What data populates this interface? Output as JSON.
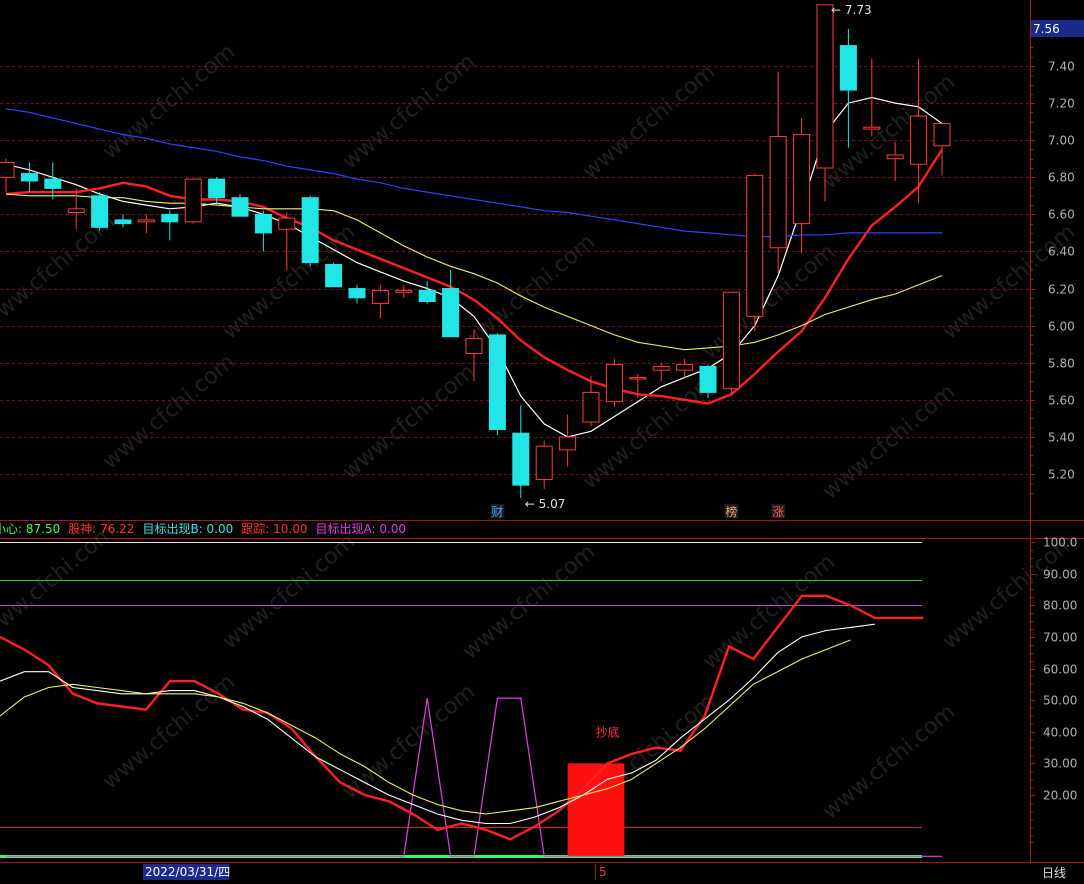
{
  "ui": {
    "date_label": "2022/03/31/四",
    "cursor_label": "5",
    "period_label": "日线",
    "current_price": "7.56",
    "high_note": "7.73",
    "low_note": "5.07",
    "signal_label": "抄底",
    "event_labels": [
      {
        "text": "财",
        "color": "#4aa8ff",
        "bar": 21
      },
      {
        "text": "榜",
        "color": "#e8b060",
        "bar": 31
      },
      {
        "text": "涨",
        "color": "#ff5050",
        "bar": 33
      }
    ],
    "watermark": "www.cfchi.com"
  },
  "legend": [
    {
      "label": "小心: ",
      "value": "87.50",
      "color": "#40ff40"
    },
    {
      "label": "股神: ",
      "value": "76.22",
      "color": "#ff3030"
    },
    {
      "label": "目标出现B: ",
      "value": "0.00",
      "color": "#40e0e0"
    },
    {
      "label": "跟踪: ",
      "value": "10.00",
      "color": "#ff3030"
    },
    {
      "label": "目标出现A: ",
      "value": "0.00",
      "color": "#e040e0"
    }
  ],
  "chart_data": [
    {
      "type": "candlestick",
      "ylim": [
        5.07,
        7.73
      ],
      "y_ticks": [
        "7.40",
        "7.20",
        "7.00",
        "6.80",
        "6.60",
        "6.40",
        "6.20",
        "6.00",
        "5.80",
        "5.60",
        "5.40",
        "5.20"
      ],
      "candles": [
        {
          "o": 6.8,
          "h": 6.9,
          "l": 6.72,
          "c": 6.88
        },
        {
          "o": 6.82,
          "h": 6.88,
          "l": 6.72,
          "c": 6.78
        },
        {
          "o": 6.79,
          "h": 6.88,
          "l": 6.68,
          "c": 6.74
        },
        {
          "o": 6.61,
          "h": 6.74,
          "l": 6.52,
          "c": 6.63
        },
        {
          "o": 6.7,
          "h": 6.72,
          "l": 6.51,
          "c": 6.53
        },
        {
          "o": 6.57,
          "h": 6.6,
          "l": 6.53,
          "c": 6.55
        },
        {
          "o": 6.56,
          "h": 6.6,
          "l": 6.5,
          "c": 6.57
        },
        {
          "o": 6.6,
          "h": 6.62,
          "l": 6.46,
          "c": 6.56
        },
        {
          "o": 6.56,
          "h": 6.79,
          "l": 6.55,
          "c": 6.79
        },
        {
          "o": 6.79,
          "h": 6.8,
          "l": 6.65,
          "c": 6.69
        },
        {
          "o": 6.69,
          "h": 6.71,
          "l": 6.59,
          "c": 6.59
        },
        {
          "o": 6.6,
          "h": 6.62,
          "l": 6.4,
          "c": 6.5
        },
        {
          "o": 6.52,
          "h": 6.61,
          "l": 6.3,
          "c": 6.58
        },
        {
          "o": 6.69,
          "h": 6.7,
          "l": 6.32,
          "c": 6.34
        },
        {
          "o": 6.33,
          "h": 6.34,
          "l": 6.21,
          "c": 6.21
        },
        {
          "o": 6.2,
          "h": 6.22,
          "l": 6.12,
          "c": 6.15
        },
        {
          "o": 6.12,
          "h": 6.22,
          "l": 6.04,
          "c": 6.19
        },
        {
          "o": 6.18,
          "h": 6.22,
          "l": 6.15,
          "c": 6.19
        },
        {
          "o": 6.19,
          "h": 6.24,
          "l": 6.12,
          "c": 6.13
        },
        {
          "o": 6.2,
          "h": 6.3,
          "l": 5.94,
          "c": 5.94
        },
        {
          "o": 5.85,
          "h": 5.98,
          "l": 5.7,
          "c": 5.93
        },
        {
          "o": 5.95,
          "h": 5.96,
          "l": 5.41,
          "c": 5.44
        },
        {
          "o": 5.42,
          "h": 5.57,
          "l": 5.07,
          "c": 5.14
        },
        {
          "o": 5.17,
          "h": 5.38,
          "l": 5.12,
          "c": 5.35
        },
        {
          "o": 5.33,
          "h": 5.52,
          "l": 5.24,
          "c": 5.4
        },
        {
          "o": 5.48,
          "h": 5.73,
          "l": 5.46,
          "c": 5.64
        },
        {
          "o": 5.59,
          "h": 5.82,
          "l": 5.56,
          "c": 5.79
        },
        {
          "o": 5.72,
          "h": 5.74,
          "l": 5.61,
          "c": 5.72
        },
        {
          "o": 5.76,
          "h": 5.8,
          "l": 5.7,
          "c": 5.78
        },
        {
          "o": 5.76,
          "h": 5.82,
          "l": 5.72,
          "c": 5.79
        },
        {
          "o": 5.78,
          "h": 5.79,
          "l": 5.61,
          "c": 5.64
        },
        {
          "o": 5.66,
          "h": 6.18,
          "l": 5.63,
          "c": 6.18
        },
        {
          "o": 6.05,
          "h": 6.82,
          "l": 5.97,
          "c": 6.81
        },
        {
          "o": 6.42,
          "h": 7.37,
          "l": 6.28,
          "c": 7.02
        },
        {
          "o": 6.55,
          "h": 7.12,
          "l": 6.39,
          "c": 7.03
        },
        {
          "o": 6.85,
          "h": 7.73,
          "l": 6.67,
          "c": 7.73
        },
        {
          "o": 7.51,
          "h": 7.6,
          "l": 6.96,
          "c": 7.27
        },
        {
          "o": 7.06,
          "h": 7.44,
          "l": 7.02,
          "c": 7.07
        },
        {
          "o": 6.9,
          "h": 6.99,
          "l": 6.78,
          "c": 6.92
        },
        {
          "o": 6.87,
          "h": 7.44,
          "l": 6.66,
          "c": 7.13
        },
        {
          "o": 6.97,
          "h": 7.09,
          "l": 6.81,
          "c": 7.09
        }
      ],
      "series": [
        {
          "name": "",
          "color": "#ffffff",
          "values": [
            6.87,
            6.84,
            6.8,
            6.76,
            6.71,
            6.67,
            6.65,
            6.63,
            6.64,
            6.66,
            6.64,
            6.6,
            6.55,
            6.48,
            6.41,
            6.34,
            6.29,
            6.24,
            6.2,
            6.15,
            6.05,
            5.87,
            5.62,
            5.47,
            5.4,
            5.43,
            5.51,
            5.59,
            5.67,
            5.72,
            5.77,
            5.85,
            6.0,
            6.27,
            6.64,
            7.04,
            7.2,
            7.23,
            7.2,
            7.18,
            7.09
          ]
        },
        {
          "name": "",
          "color": "#ff2020",
          "values": [
            6.71,
            6.72,
            6.72,
            6.72,
            6.74,
            6.77,
            6.75,
            6.7,
            6.68,
            6.68,
            6.67,
            6.64,
            6.58,
            6.53,
            6.46,
            6.41,
            6.36,
            6.31,
            6.26,
            6.21,
            6.14,
            6.04,
            5.92,
            5.83,
            5.76,
            5.7,
            5.66,
            5.63,
            5.62,
            5.6,
            5.58,
            5.63,
            5.74,
            5.86,
            5.97,
            6.15,
            6.36,
            6.54,
            6.64,
            6.75,
            6.95
          ]
        },
        {
          "name": "",
          "color": "#f0f060",
          "values": [
            6.71,
            6.7,
            6.7,
            6.7,
            6.69,
            6.69,
            6.67,
            6.66,
            6.66,
            6.65,
            6.64,
            6.63,
            6.63,
            6.63,
            6.62,
            6.57,
            6.5,
            6.43,
            6.37,
            6.32,
            6.28,
            6.23,
            6.16,
            6.1,
            6.05,
            6.0,
            5.95,
            5.91,
            5.89,
            5.87,
            5.88,
            5.89,
            5.91,
            5.95,
            6.0,
            6.06,
            6.1,
            6.14,
            6.17,
            6.22,
            6.27
          ]
        },
        {
          "name": "",
          "color": "#3040ff",
          "values": [
            7.17,
            7.15,
            7.12,
            7.09,
            7.06,
            7.03,
            7.01,
            6.98,
            6.96,
            6.94,
            6.91,
            6.89,
            6.86,
            6.84,
            6.82,
            6.79,
            6.77,
            6.74,
            6.72,
            6.7,
            6.68,
            6.66,
            6.64,
            6.62,
            6.61,
            6.59,
            6.57,
            6.55,
            6.53,
            6.51,
            6.5,
            6.49,
            6.48,
            6.48,
            6.49,
            6.49,
            6.5,
            6.5,
            6.5,
            6.5,
            6.5
          ]
        }
      ]
    },
    {
      "type": "line",
      "ylim": [
        0,
        100
      ],
      "y_ticks": [
        "100.0",
        "90.00",
        "80.00",
        "70.00",
        "60.00",
        "50.00",
        "40.00",
        "30.00",
        "20.00"
      ],
      "hlines": [
        {
          "y": 100,
          "color": "#e8e8e8"
        },
        {
          "y": 88,
          "color": "#40c040"
        },
        {
          "y": 80,
          "color": "#d040d0"
        },
        {
          "y": 10,
          "color": "#e02020"
        },
        {
          "y": 0,
          "color": "#30ff60"
        }
      ],
      "series": [
        {
          "name": "",
          "color": "#ff2020",
          "values": [
            70,
            66,
            61,
            52,
            49,
            48,
            47,
            56,
            56,
            52,
            47,
            46,
            41,
            32,
            24,
            20,
            18,
            14,
            9,
            11,
            9,
            6,
            10,
            15,
            22,
            30,
            33,
            35,
            34,
            45,
            67,
            63,
            73,
            83,
            83,
            80,
            76,
            76,
            76
          ]
        },
        {
          "name": "",
          "color": "#ffffff",
          "values": [
            56,
            59,
            59,
            54,
            53,
            52,
            52,
            53,
            53,
            51,
            48,
            44,
            38,
            32,
            28,
            24,
            20,
            17,
            14,
            12,
            11,
            11,
            13,
            16,
            20,
            25,
            27,
            31,
            38,
            44,
            50,
            57,
            65,
            70,
            72,
            73,
            74
          ]
        },
        {
          "name": "",
          "color": "#f0f060",
          "values": [
            45,
            51,
            54,
            55,
            54,
            53,
            52,
            52,
            52,
            51,
            49,
            46,
            42,
            38,
            33,
            29,
            24,
            20,
            17,
            15,
            14,
            15,
            16,
            18,
            20,
            22,
            25,
            30,
            35,
            41,
            48,
            55,
            59,
            63,
            66,
            69
          ]
        }
      ],
      "target_a": [
        0,
        0,
        0,
        0,
        0,
        0,
        0,
        0,
        0,
        0,
        0,
        0,
        0,
        0,
        0,
        0,
        0,
        0,
        50,
        0,
        0,
        50,
        50,
        0,
        0,
        0,
        0,
        0,
        0,
        0,
        0,
        0,
        0,
        0,
        0,
        0,
        0,
        0,
        0,
        0,
        0
      ],
      "signal_bar": {
        "from": 24,
        "to": 26,
        "value": 30
      }
    }
  ]
}
